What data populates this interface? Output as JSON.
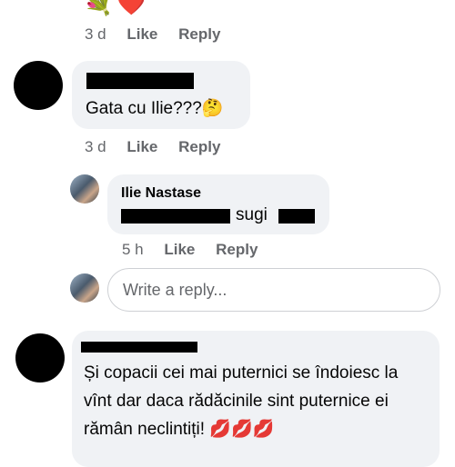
{
  "top_comment": {
    "emoji": "💐❤️",
    "time": "3 d",
    "like_label": "Like",
    "reply_label": "Reply"
  },
  "comment_2": {
    "text": "Gata cu Ilie???🤔",
    "time": "3 d",
    "like_label": "Like",
    "reply_label": "Reply"
  },
  "reply_1": {
    "author": "Ilie Nastase",
    "text_suffix": "sugi",
    "time": "5 h",
    "like_label": "Like",
    "reply_label": "Reply"
  },
  "reply_box": {
    "placeholder": "Write a reply..."
  },
  "comment_3": {
    "text": "Și copacii cei mai puternici se îndoiesc la vînt dar daca rădăcinile sint puternice ei rămân neclintiți! 💋💋💋"
  },
  "colors": {
    "bubble": "#f0f2f5",
    "meta_text": "#65676b",
    "link": "#385898"
  }
}
